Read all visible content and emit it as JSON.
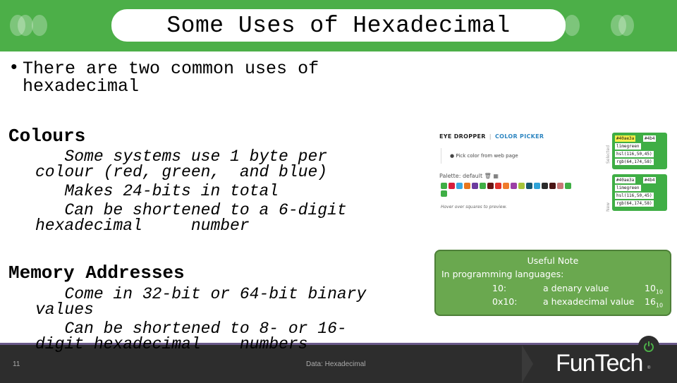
{
  "header": {
    "title": "Some Uses of Hexadecimal",
    "accent_color": "#4caf48"
  },
  "intro": {
    "bullet": "•",
    "text": "There are two common uses of hexadecimal"
  },
  "sections": [
    {
      "heading": "Colours",
      "lines": [
        "   Some systems use 1 byte per",
        "colour (red, green,  and blue)",
        "   Makes 24-bits in total",
        "   Can be shortened to a 6-digit",
        "hexadecimal     number"
      ]
    },
    {
      "heading": "Memory Addresses",
      "lines": [
        "   Come in 32-bit or 64-bit binary",
        "values",
        "   Can be shortened to 8- or 16-",
        "digit hexadecimal    numbers"
      ]
    }
  ],
  "color_picker": {
    "tab_eyedropper": "EYE DROPPER",
    "tab_separator": "|",
    "tab_colorpicker": "COLOR PICKER",
    "pick_button": "Pick color from web page",
    "palette_label": "Palette: default",
    "swatches": [
      "#3fae45",
      "#d81e3c",
      "#3aa8e0",
      "#e8761e",
      "#6b3b9e",
      "#3fae45",
      "#6b1414",
      "#e0302c",
      "#f07b2b",
      "#9b3fa6",
      "#a6c43a",
      "#17566e",
      "#2ea3d8",
      "#2b2b2b",
      "#4a1515",
      "#c87676",
      "#3fae45",
      "#3fae45"
    ],
    "hover_hint": "Hover over squares to preview.",
    "selected_label": "Selected",
    "new_label": "New",
    "selected": {
      "hex": "#40ae3a",
      "short": "#4b4",
      "name": "limegreen",
      "hsl": "hsl(116,50,45)",
      "rgb": "rgb(64,174,58)"
    },
    "new": {
      "hex": "#40ae3a",
      "short": "#4b4",
      "name": "limegreen",
      "hsl": "hsl(116,50,45)",
      "rgb": "rgb(64,174,58)"
    }
  },
  "note": {
    "title": "Useful Note",
    "line1": "In programming languages:",
    "rows": [
      {
        "code": "10:",
        "desc": "a denary value",
        "value": "10",
        "base": "10"
      },
      {
        "code": "0x10:",
        "desc": "a hexadecimal value",
        "value": "16",
        "base": "10"
      }
    ]
  },
  "footer": {
    "page_number": "11",
    "caption": "Data: Hexadecimal",
    "logo": "FunTech",
    "logo_mark": "®"
  }
}
